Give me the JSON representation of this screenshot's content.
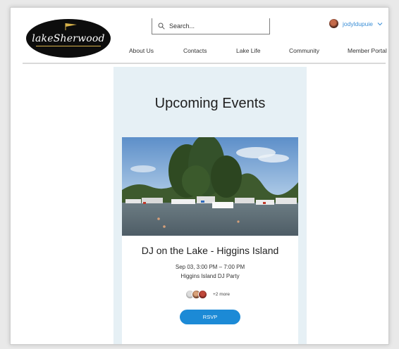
{
  "header": {
    "logo_text": "lakeSherwood",
    "search_placeholder": "Search...",
    "user_name": "jodyldupuie",
    "nav": [
      {
        "label": "About Us"
      },
      {
        "label": "Contacts"
      },
      {
        "label": "Lake Life"
      },
      {
        "label": "Community"
      },
      {
        "label": "Member Portal"
      }
    ]
  },
  "events": {
    "section_title": "Upcoming Events",
    "items": [
      {
        "title": "DJ on the Lake - Higgins Island",
        "date_time": "Sep 03, 3:00 PM – 7:00 PM",
        "subtitle": "Higgins Island DJ Party",
        "attendees_more": "+2 more",
        "rsvp_label": "RSVP"
      }
    ]
  },
  "colors": {
    "accent": "#1c8ad6",
    "panel_bg": "#e6f0f5",
    "logo_bg": "#0d0d0d",
    "user_link": "#3a8ed6"
  },
  "icons": [
    "search-icon",
    "chevron-down-icon",
    "flag-icon"
  ]
}
